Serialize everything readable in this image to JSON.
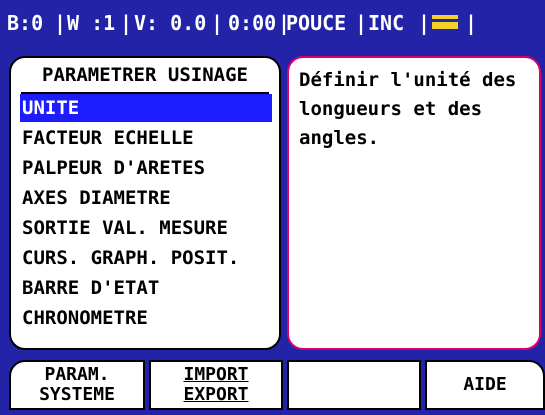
{
  "status_bar": {
    "b": "B:0",
    "w": "W :1",
    "v": "V: 0.0",
    "time": "0:00",
    "unit": "POUCE",
    "mode": "INC",
    "icon": "battery-icon"
  },
  "menu": {
    "title": "PARAMETRER USINAGE",
    "items": [
      {
        "label": "UNITE",
        "selected": true
      },
      {
        "label": "FACTEUR ECHELLE"
      },
      {
        "label": "PALPEUR D'ARETES"
      },
      {
        "label": "AXES DIAMETRE"
      },
      {
        "label": "SORTIE VAL. MESURE"
      },
      {
        "label": "CURS. GRAPH. POSIT."
      },
      {
        "label": "BARRE D'ETAT"
      },
      {
        "label": "CHRONOMETRE"
      }
    ]
  },
  "help": {
    "text": "Définir l'unité des\nlongueurs et des\nangles."
  },
  "softkeys": {
    "param_line1": "PARAM.",
    "param_line2": "SYSTEME",
    "import_line1": "IMPORT",
    "import_line2": "EXPORT",
    "blank": "",
    "aide": "AIDE"
  },
  "colors": {
    "background": "#2323a8",
    "selection": "#1c1cff",
    "help_border": "#d8006a",
    "icon": "#f2d22a"
  }
}
